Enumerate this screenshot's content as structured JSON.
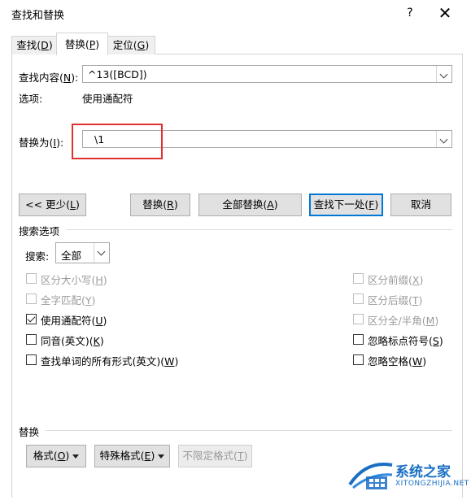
{
  "window": {
    "title": "查找和替换",
    "help": "?",
    "close": "✕"
  },
  "tabs": [
    {
      "label": "查找(",
      "key": "D",
      "tail": ")"
    },
    {
      "label": "替换(",
      "key": "P",
      "tail": ")"
    },
    {
      "label": "定位(",
      "key": "G",
      "tail": ")"
    }
  ],
  "find": {
    "label": "查找内容(",
    "key": "N",
    "tail": "):",
    "value": "^13([BCD])"
  },
  "options": {
    "label": "选项:",
    "value": "使用通配符"
  },
  "replace": {
    "label": "替换为(",
    "key": "I",
    "tail": "):",
    "value": "\\1"
  },
  "buttons": {
    "less": {
      "label": "<< 更少(",
      "key": "L",
      "tail": ")"
    },
    "replace": {
      "label": "替换(",
      "key": "R",
      "tail": ")"
    },
    "replace_all": {
      "label": "全部替换(",
      "key": "A",
      "tail": ")"
    },
    "find_next": {
      "label": "查找下一处(",
      "key": "F",
      "tail": ")"
    },
    "cancel": {
      "label": "取消"
    }
  },
  "search_options": {
    "heading": "搜索选项",
    "search_label": "搜索:",
    "search_value": "全部",
    "left": [
      {
        "label": "区分大小写(",
        "key": "H",
        "tail": ")",
        "checked": false,
        "disabled": true
      },
      {
        "label": "全字匹配(",
        "key": "Y",
        "tail": ")",
        "checked": false,
        "disabled": true
      },
      {
        "label": "使用通配符(",
        "key": "U",
        "tail": ")",
        "checked": true,
        "disabled": false
      },
      {
        "label": "同音(英文)(",
        "key": "K",
        "tail": ")",
        "checked": false,
        "disabled": false
      },
      {
        "label": "查找单词的所有形式(英文)(",
        "key": "W",
        "tail": ")",
        "checked": false,
        "disabled": false
      }
    ],
    "right": [
      {
        "label": "区分前缀(",
        "key": "X",
        "tail": ")",
        "checked": false,
        "disabled": true
      },
      {
        "label": "区分后缀(",
        "key": "T",
        "tail": ")",
        "checked": false,
        "disabled": true
      },
      {
        "label": "区分全/半角(",
        "key": "M",
        "tail": ")",
        "checked": false,
        "disabled": true
      },
      {
        "label": "忽略标点符号(",
        "key": "S",
        "tail": ")",
        "checked": false,
        "disabled": false
      },
      {
        "label": "忽略空格(",
        "key": "W",
        "tail": ")",
        "checked": false,
        "disabled": false
      }
    ]
  },
  "replace_section": {
    "heading": "替换",
    "format": {
      "label": "格式(",
      "key": "O",
      "tail": ")"
    },
    "special": {
      "label": "特殊格式(",
      "key": "E",
      "tail": ")"
    },
    "no_format": {
      "label": "不限定格式(",
      "key": "T",
      "tail": ")"
    }
  },
  "watermark": {
    "brand": "系统之家",
    "url": "XITONGZHIJIA.NET"
  },
  "colors": {
    "accent": "#0078d7",
    "highlight": "#e03030",
    "disabled": "#9b9b9b",
    "watermark": "#1a6fc4"
  }
}
